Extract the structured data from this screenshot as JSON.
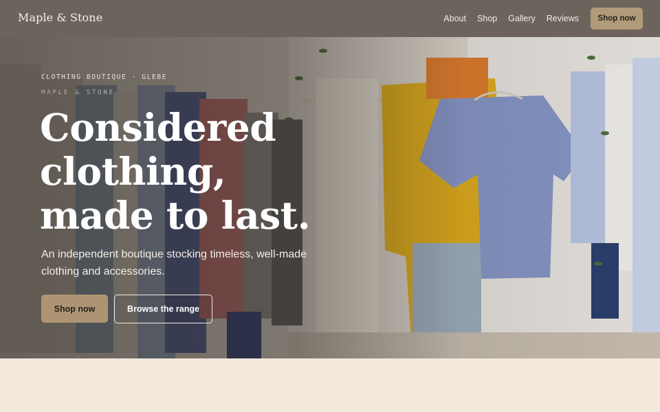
{
  "nav": {
    "brand": "Maple & Stone",
    "links": [
      "About",
      "Shop",
      "Gallery",
      "Reviews"
    ],
    "cta": "Shop now"
  },
  "hero": {
    "eyebrow": "CLOTHING BOUTIQUE · GLEBE",
    "subbrand": "MAPLE & STONE",
    "headline": "Considered clothing, made to last.",
    "subtitle": "An independent boutique stocking timeless, well-made clothing and accessories.",
    "primary_button": "Shop now",
    "secondary_button": "Browse the range"
  },
  "colors": {
    "nav_bg": "#6c645c",
    "accent": "#ad9574",
    "page_bg": "#f2e9dc"
  }
}
